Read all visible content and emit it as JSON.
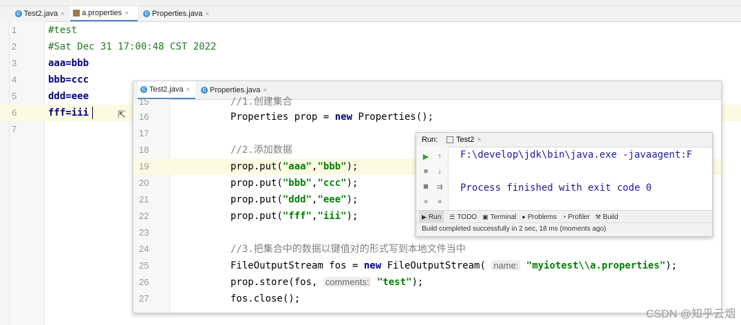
{
  "back_editor": {
    "tabs": [
      {
        "label": "Test2.java",
        "icon": "java-class-icon"
      },
      {
        "label": "a.properties",
        "icon": "properties-file-icon"
      },
      {
        "label": "Properties.java",
        "icon": "java-class-icon"
      }
    ],
    "lines": [
      {
        "n": "1",
        "text": "#test"
      },
      {
        "n": "2",
        "text": "#Sat Dec 31 17:00:48 CST 2022"
      },
      {
        "n": "3",
        "text": "aaa=bbb"
      },
      {
        "n": "4",
        "text": "bbb=ccc"
      },
      {
        "n": "5",
        "text": "ddd=eee"
      },
      {
        "n": "6",
        "text": "fff=iii"
      },
      {
        "n": "7",
        "text": ""
      }
    ]
  },
  "front_editor": {
    "tabs": [
      {
        "label": "Test2.java",
        "icon": "java-class-icon"
      },
      {
        "label": "Properties.java",
        "icon": "java-class-icon"
      }
    ],
    "lines": [
      {
        "n": "15",
        "code": "//1.创建集合"
      },
      {
        "n": "16",
        "code": "Properties prop = new Properties();"
      },
      {
        "n": "17",
        "code": ""
      },
      {
        "n": "18",
        "code": "//2.添加数据"
      },
      {
        "n": "19",
        "code": "prop.put(\"aaa\",\"bbb\");"
      },
      {
        "n": "20",
        "code": "prop.put(\"bbb\",\"ccc\");"
      },
      {
        "n": "21",
        "code": "prop.put(\"ddd\",\"eee\");"
      },
      {
        "n": "22",
        "code": "prop.put(\"fff\",\"iii\");"
      },
      {
        "n": "23",
        "code": ""
      },
      {
        "n": "24",
        "code": "//3.把集合中的数据以键值对的形式写到本地文件当中"
      },
      {
        "n": "25",
        "code": "FileOutputStream fos = new FileOutputStream( name: \"myiotest\\\\a.properties\");"
      },
      {
        "n": "26",
        "code": "prop.store(fos, comments: \"test\");"
      },
      {
        "n": "27",
        "code": "fos.close();"
      }
    ]
  },
  "run_panel": {
    "label": "Run:",
    "tab": "Test2",
    "output_lines": [
      "F:\\develop\\jdk\\bin\\java.exe -javaagent:F",
      "Process finished with exit code 0"
    ],
    "bottom_tabs": [
      "Run",
      "TODO",
      "Terminal",
      "Problems",
      "Profiler",
      "Build"
    ],
    "status": "Build completed successfully in 2 sec, 18 ms (moments ago)"
  },
  "watermark": "CSDN @知乎云烟"
}
